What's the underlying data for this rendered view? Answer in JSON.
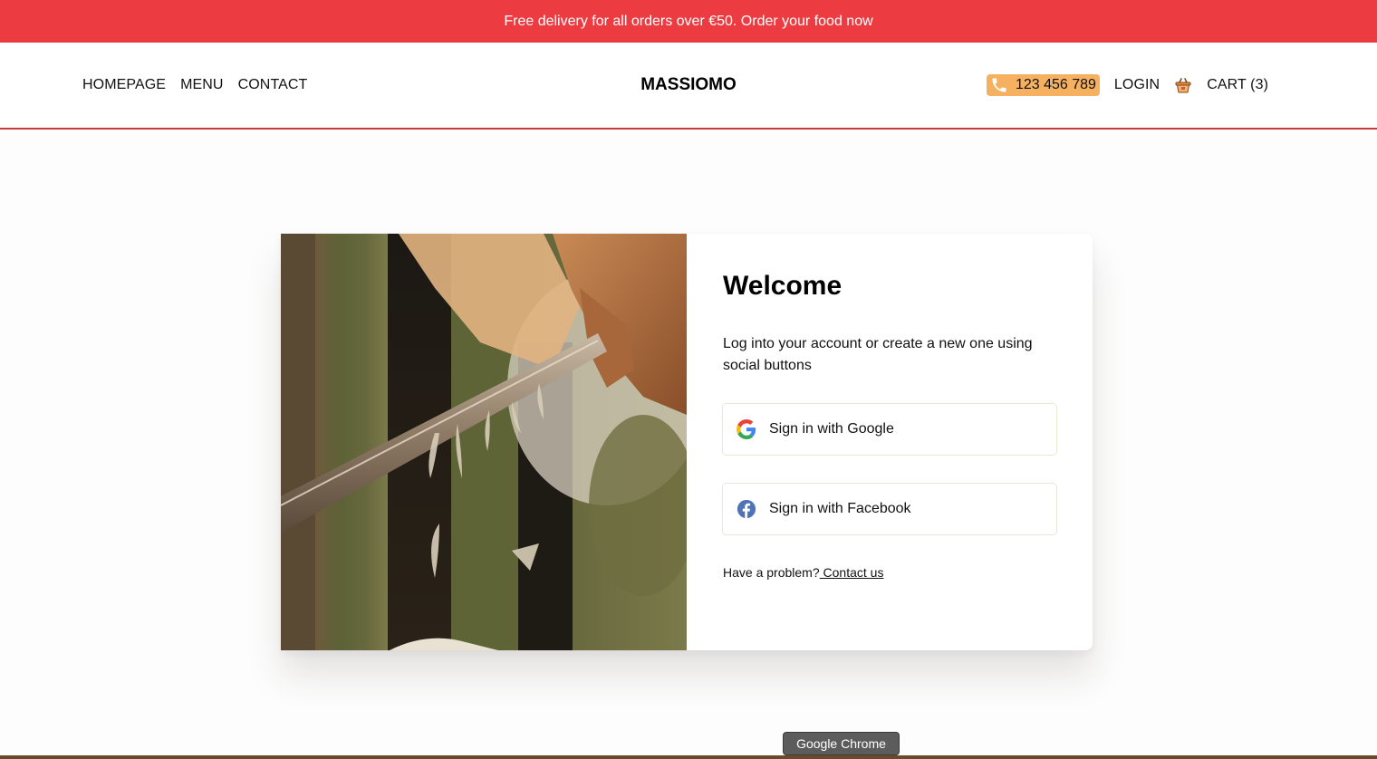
{
  "promo": {
    "text": "Free delivery for all orders over €50. Order your food now"
  },
  "nav": {
    "links": [
      "HOMEPAGE",
      "MENU",
      "CONTACT"
    ],
    "brand": "MASSIOMO",
    "phone": "123 456 789",
    "login": "LOGIN",
    "cart": "CART (3)"
  },
  "login_card": {
    "title": "Welcome",
    "description": "Log into your account or create a new one using social buttons",
    "google_button": "Sign in with Google",
    "facebook_button": "Sign in with Facebook",
    "problem_text": "Have a problem?",
    "contact_link": " Contact us"
  },
  "tooltip": {
    "text": "Google Chrome"
  },
  "colors": {
    "promo_bg": "#ec3c41",
    "accent_line": "#c8393c",
    "phone_badge": "#f6b160"
  },
  "icons": [
    "phone-icon",
    "cart-icon",
    "google-icon",
    "facebook-icon"
  ]
}
